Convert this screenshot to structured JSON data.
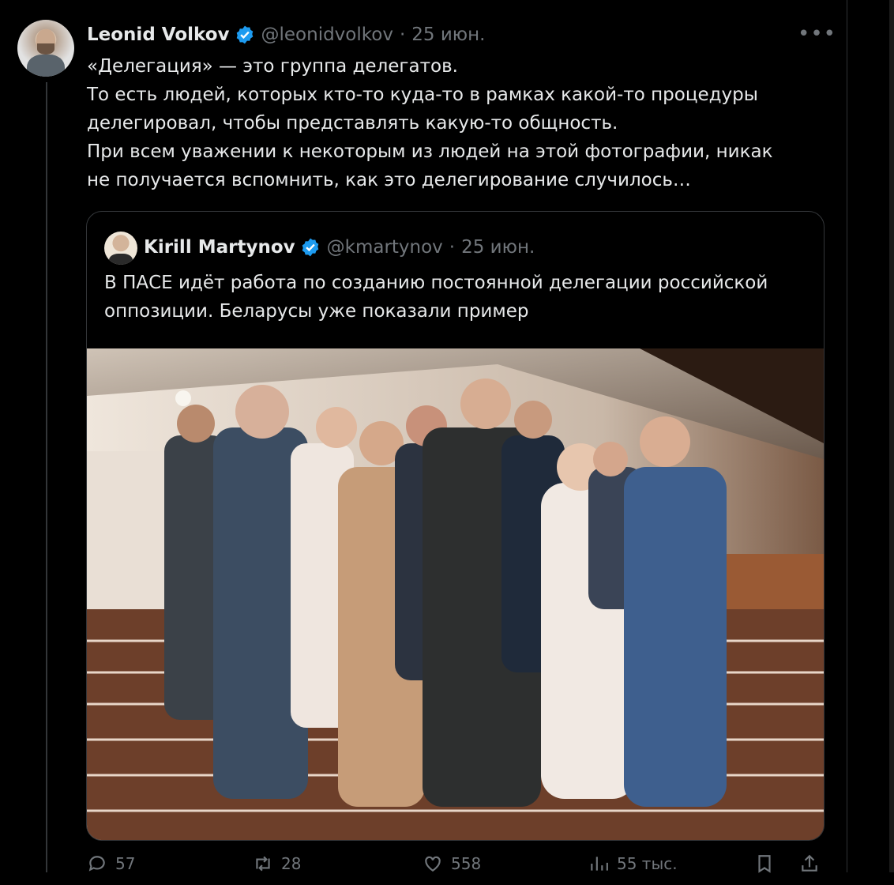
{
  "tweet": {
    "author_name": "Leonid Volkov",
    "handle": "@leonidvolkov",
    "separator": "·",
    "date": "25 июн.",
    "more": "•••",
    "lines": [
      "«Делегация» — это группа делегатов.",
      "То есть людей, которых кто-то куда-то в рамках какой-то процедуры",
      "делегировал, чтобы представлять какую-то общность.",
      "При всем уважении к некоторым из людей на этой фотографии, никак",
      "не получается вспомнить, как это делегирование случилось…"
    ]
  },
  "quoted": {
    "author_name": "Kirill Martynov",
    "handle": "@kmartynov",
    "separator": "·",
    "date": "25 июн.",
    "lines": [
      "В ПАСЕ идёт работа по созданию постоянной делегации российской",
      "оппозиции. Беларусы уже показали пример"
    ]
  },
  "actions": {
    "replies": "57",
    "retweets": "28",
    "likes": "558",
    "views": "55 тыс."
  },
  "colors": {
    "background": "#000000",
    "text": "#e7e9ea",
    "muted": "#71767b",
    "verified": "#1d9bf0",
    "border": "#2f3336"
  },
  "icons": [
    "verified-badge-icon",
    "more-icon",
    "reply-icon",
    "retweet-icon",
    "like-icon",
    "views-icon",
    "bookmark-icon",
    "share-icon"
  ]
}
